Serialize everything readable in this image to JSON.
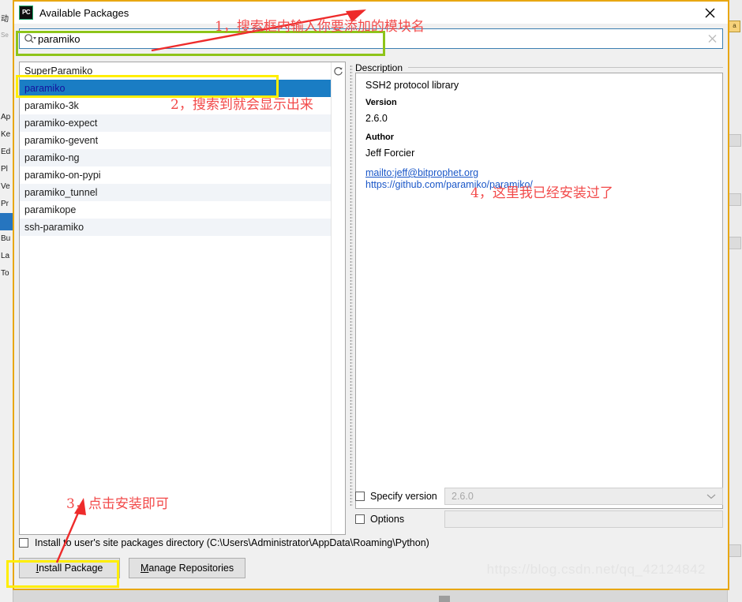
{
  "window": {
    "title": "Available Packages",
    "app_icon": "pycharm-icon",
    "close_icon": "close-icon"
  },
  "search": {
    "value": "paramiko",
    "placeholder": "",
    "search_icon": "search-icon",
    "clear_icon": "clear-icon"
  },
  "package_list": {
    "refresh_icon": "refresh-icon",
    "items": [
      {
        "name": "SuperParamiko",
        "selected": false
      },
      {
        "name": "paramiko",
        "selected": true
      },
      {
        "name": "paramiko-3k",
        "selected": false
      },
      {
        "name": "paramiko-expect",
        "selected": false
      },
      {
        "name": "paramiko-gevent",
        "selected": false
      },
      {
        "name": "paramiko-ng",
        "selected": false
      },
      {
        "name": "paramiko-on-pypi",
        "selected": false
      },
      {
        "name": "paramiko_tunnel",
        "selected": false
      },
      {
        "name": "paramikope",
        "selected": false
      },
      {
        "name": "ssh-paramiko",
        "selected": false
      }
    ]
  },
  "description": {
    "legend": "Description",
    "summary": "SSH2 protocol library",
    "version_label": "Version",
    "version_value": "2.6.0",
    "author_label": "Author",
    "author_value": "Jeff Forcier",
    "mail_link": "mailto:jeff@bitprophet.org",
    "home_link": "https://github.com/paramiko/paramiko/"
  },
  "options": {
    "specify_version_label": "Specify version",
    "specify_version_checked": false,
    "specify_version_value": "2.6.0",
    "dropdown_icon": "chevron-down-icon",
    "options_label": "Options",
    "options_checked": false,
    "options_value": ""
  },
  "bottom": {
    "user_site_label": "Install to user's site packages directory (C:\\Users\\Administrator\\AppData\\Roaming\\Python)",
    "user_site_checked": false,
    "install_button_mnemonic": "I",
    "install_button_rest": "nstall Package",
    "manage_button_mnemonic": "M",
    "manage_button_rest": "anage Repositories"
  },
  "annotations": [
    {
      "id": "step-1",
      "text": "1，搜索框内输入你要添加的模块名"
    },
    {
      "id": "step-2",
      "text": "2，搜索到就会显示出来"
    },
    {
      "id": "step-3",
      "text": "3，点击安装即可"
    },
    {
      "id": "step-4",
      "text": "4，这里我已经安装过了"
    }
  ],
  "watermark": "https://blog.csdn.net/qq_42124842",
  "background_window": {
    "items": [
      "动",
      "Se",
      "Ap",
      "Ke",
      "Ed",
      "Pl",
      "Ve",
      "Pr",
      "",
      "Bu",
      "La",
      "To"
    ]
  },
  "colors": {
    "window_border": "#e8a712",
    "selection_blue": "#1a7dc4",
    "selection_text": "#16109c",
    "annotation_red": "#f24a4a",
    "highlight_green": "#8ec419",
    "highlight_yellow": "#ffee00",
    "link_blue": "#1a57c8"
  }
}
